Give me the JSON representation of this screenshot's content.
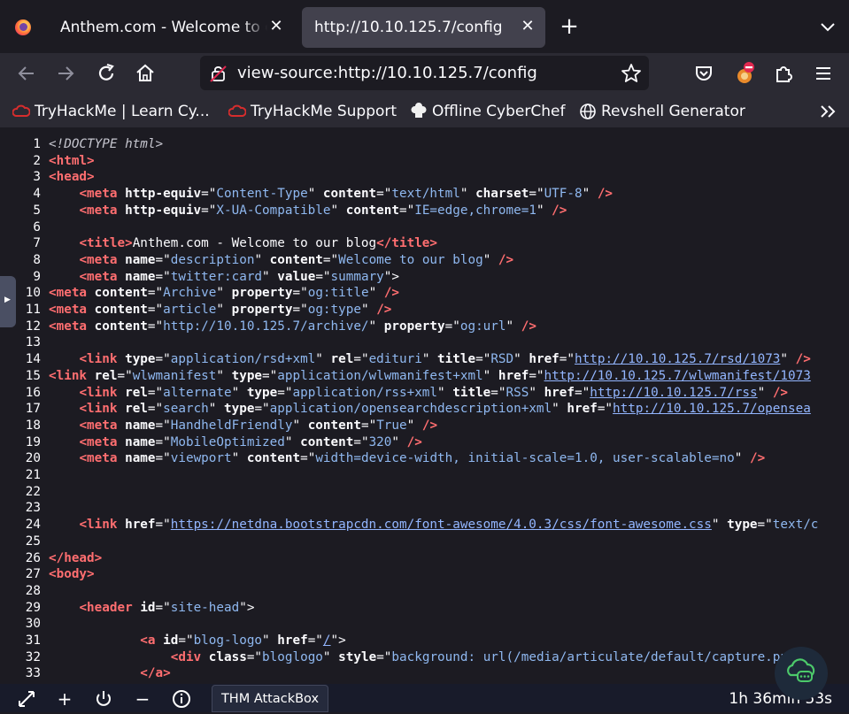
{
  "tabs": [
    {
      "title": "Anthem.com - Welcome to our blog",
      "active": false
    },
    {
      "title": "http://10.10.125.7/config",
      "active": true
    }
  ],
  "urlbar": {
    "value": "view-source:http://10.10.125.7/config"
  },
  "bookmarks": [
    {
      "label": "TryHackMe | Learn Cy...",
      "icon": "tryhackme-cloud-icon"
    },
    {
      "label": "TryHackMe Support",
      "icon": "tryhackme-cloud-icon"
    },
    {
      "label": "Offline CyberChef",
      "icon": "chef-hat-icon"
    },
    {
      "label": "Revshell Generator",
      "icon": "globe-icon"
    }
  ],
  "source_lines": [
    [
      [
        "c",
        "<!DOCTYPE html>"
      ]
    ],
    [
      [
        "t",
        "<html>"
      ]
    ],
    [
      [
        "t",
        "<head>"
      ]
    ],
    [
      [
        "p",
        "    "
      ],
      [
        "t",
        "<meta "
      ],
      [
        "a",
        "http-equiv"
      ],
      [
        "p",
        "=\""
      ],
      [
        "v",
        "Content-Type"
      ],
      [
        "p",
        "\" "
      ],
      [
        "a",
        "content"
      ],
      [
        "p",
        "=\""
      ],
      [
        "v",
        "text/html"
      ],
      [
        "p",
        "\" "
      ],
      [
        "a",
        "charset"
      ],
      [
        "p",
        "=\""
      ],
      [
        "v",
        "UTF-8"
      ],
      [
        "p",
        "\" "
      ],
      [
        "t",
        "/>"
      ]
    ],
    [
      [
        "p",
        "    "
      ],
      [
        "t",
        "<meta "
      ],
      [
        "a",
        "http-equiv"
      ],
      [
        "p",
        "=\""
      ],
      [
        "v",
        "X-UA-Compatible"
      ],
      [
        "p",
        "\" "
      ],
      [
        "a",
        "content"
      ],
      [
        "p",
        "=\""
      ],
      [
        "v",
        "IE=edge,chrome=1"
      ],
      [
        "p",
        "\" "
      ],
      [
        "t",
        "/>"
      ]
    ],
    [],
    [
      [
        "p",
        "    "
      ],
      [
        "t",
        "<title>"
      ],
      [
        "p",
        "Anthem.com - Welcome to our blog"
      ],
      [
        "t",
        "</title>"
      ]
    ],
    [
      [
        "p",
        "    "
      ],
      [
        "t",
        "<meta "
      ],
      [
        "a",
        "name"
      ],
      [
        "p",
        "=\""
      ],
      [
        "v",
        "description"
      ],
      [
        "p",
        "\" "
      ],
      [
        "a",
        "content"
      ],
      [
        "p",
        "=\""
      ],
      [
        "v",
        "Welcome to our blog"
      ],
      [
        "p",
        "\" "
      ],
      [
        "t",
        "/>"
      ]
    ],
    [
      [
        "p",
        "    "
      ],
      [
        "t",
        "<meta "
      ],
      [
        "a",
        "name"
      ],
      [
        "p",
        "=\""
      ],
      [
        "v",
        "twitter:card"
      ],
      [
        "p",
        "\" "
      ],
      [
        "a",
        "value"
      ],
      [
        "p",
        "=\""
      ],
      [
        "v",
        "summary"
      ],
      [
        "p",
        "\">"
      ]
    ],
    [
      [
        "t",
        "<meta "
      ],
      [
        "a",
        "content"
      ],
      [
        "p",
        "=\""
      ],
      [
        "v",
        "Archive"
      ],
      [
        "p",
        "\" "
      ],
      [
        "a",
        "property"
      ],
      [
        "p",
        "=\""
      ],
      [
        "v",
        "og:title"
      ],
      [
        "p",
        "\" "
      ],
      [
        "t",
        "/>"
      ]
    ],
    [
      [
        "t",
        "<meta "
      ],
      [
        "a",
        "content"
      ],
      [
        "p",
        "=\""
      ],
      [
        "v",
        "article"
      ],
      [
        "p",
        "\" "
      ],
      [
        "a",
        "property"
      ],
      [
        "p",
        "=\""
      ],
      [
        "v",
        "og:type"
      ],
      [
        "p",
        "\" "
      ],
      [
        "t",
        "/>"
      ]
    ],
    [
      [
        "t",
        "<meta "
      ],
      [
        "a",
        "content"
      ],
      [
        "p",
        "=\""
      ],
      [
        "v",
        "http://10.10.125.7/archive/"
      ],
      [
        "p",
        "\" "
      ],
      [
        "a",
        "property"
      ],
      [
        "p",
        "=\""
      ],
      [
        "v",
        "og:url"
      ],
      [
        "p",
        "\" "
      ],
      [
        "t",
        "/>"
      ]
    ],
    [],
    [
      [
        "p",
        "    "
      ],
      [
        "t",
        "<link "
      ],
      [
        "a",
        "type"
      ],
      [
        "p",
        "=\""
      ],
      [
        "v",
        "application/rsd+xml"
      ],
      [
        "p",
        "\" "
      ],
      [
        "a",
        "rel"
      ],
      [
        "p",
        "=\""
      ],
      [
        "v",
        "edituri"
      ],
      [
        "p",
        "\" "
      ],
      [
        "a",
        "title"
      ],
      [
        "p",
        "=\""
      ],
      [
        "v",
        "RSD"
      ],
      [
        "p",
        "\" "
      ],
      [
        "a",
        "href"
      ],
      [
        "p",
        "=\""
      ],
      [
        "l",
        "http://10.10.125.7/rsd/1073"
      ],
      [
        "p",
        "\" "
      ],
      [
        "t",
        "/>"
      ]
    ],
    [
      [
        "t",
        "<link "
      ],
      [
        "a",
        "rel"
      ],
      [
        "p",
        "=\""
      ],
      [
        "v",
        "wlwmanifest"
      ],
      [
        "p",
        "\" "
      ],
      [
        "a",
        "type"
      ],
      [
        "p",
        "=\""
      ],
      [
        "v",
        "application/wlwmanifest+xml"
      ],
      [
        "p",
        "\" "
      ],
      [
        "a",
        "href"
      ],
      [
        "p",
        "=\""
      ],
      [
        "l",
        "http://10.10.125.7/wlwmanifest/1073"
      ]
    ],
    [
      [
        "p",
        "    "
      ],
      [
        "t",
        "<link "
      ],
      [
        "a",
        "rel"
      ],
      [
        "p",
        "=\""
      ],
      [
        "v",
        "alternate"
      ],
      [
        "p",
        "\" "
      ],
      [
        "a",
        "type"
      ],
      [
        "p",
        "=\""
      ],
      [
        "v",
        "application/rss+xml"
      ],
      [
        "p",
        "\" "
      ],
      [
        "a",
        "title"
      ],
      [
        "p",
        "=\""
      ],
      [
        "v",
        "RSS"
      ],
      [
        "p",
        "\" "
      ],
      [
        "a",
        "href"
      ],
      [
        "p",
        "=\""
      ],
      [
        "l",
        "http://10.10.125.7/rss"
      ],
      [
        "p",
        "\" "
      ],
      [
        "t",
        "/>"
      ]
    ],
    [
      [
        "p",
        "    "
      ],
      [
        "t",
        "<link "
      ],
      [
        "a",
        "rel"
      ],
      [
        "p",
        "=\""
      ],
      [
        "v",
        "search"
      ],
      [
        "p",
        "\" "
      ],
      [
        "a",
        "type"
      ],
      [
        "p",
        "=\""
      ],
      [
        "v",
        "application/opensearchdescription+xml"
      ],
      [
        "p",
        "\" "
      ],
      [
        "a",
        "href"
      ],
      [
        "p",
        "=\""
      ],
      [
        "l",
        "http://10.10.125.7/opensea"
      ]
    ],
    [
      [
        "p",
        "    "
      ],
      [
        "t",
        "<meta "
      ],
      [
        "a",
        "name"
      ],
      [
        "p",
        "=\""
      ],
      [
        "v",
        "HandheldFriendly"
      ],
      [
        "p",
        "\" "
      ],
      [
        "a",
        "content"
      ],
      [
        "p",
        "=\""
      ],
      [
        "v",
        "True"
      ],
      [
        "p",
        "\" "
      ],
      [
        "t",
        "/>"
      ]
    ],
    [
      [
        "p",
        "    "
      ],
      [
        "t",
        "<meta "
      ],
      [
        "a",
        "name"
      ],
      [
        "p",
        "=\""
      ],
      [
        "v",
        "MobileOptimized"
      ],
      [
        "p",
        "\" "
      ],
      [
        "a",
        "content"
      ],
      [
        "p",
        "=\""
      ],
      [
        "v",
        "320"
      ],
      [
        "p",
        "\" "
      ],
      [
        "t",
        "/>"
      ]
    ],
    [
      [
        "p",
        "    "
      ],
      [
        "t",
        "<meta "
      ],
      [
        "a",
        "name"
      ],
      [
        "p",
        "=\""
      ],
      [
        "v",
        "viewport"
      ],
      [
        "p",
        "\" "
      ],
      [
        "a",
        "content"
      ],
      [
        "p",
        "=\""
      ],
      [
        "v",
        "width=device-width, initial-scale=1.0, user-scalable=no"
      ],
      [
        "p",
        "\" "
      ],
      [
        "t",
        "/>"
      ]
    ],
    [],
    [],
    [],
    [
      [
        "p",
        "    "
      ],
      [
        "t",
        "<link "
      ],
      [
        "a",
        "href"
      ],
      [
        "p",
        "=\""
      ],
      [
        "l",
        "https://netdna.bootstrapcdn.com/font-awesome/4.0.3/css/font-awesome.css"
      ],
      [
        "p",
        "\" "
      ],
      [
        "a",
        "type"
      ],
      [
        "p",
        "=\""
      ],
      [
        "v",
        "text/c"
      ]
    ],
    [],
    [
      [
        "t",
        "</head>"
      ]
    ],
    [
      [
        "t",
        "<body>"
      ]
    ],
    [],
    [
      [
        "p",
        "    "
      ],
      [
        "t",
        "<header "
      ],
      [
        "a",
        "id"
      ],
      [
        "p",
        "=\""
      ],
      [
        "v",
        "site-head"
      ],
      [
        "p",
        "\">"
      ]
    ],
    [],
    [
      [
        "p",
        "            "
      ],
      [
        "t",
        "<a "
      ],
      [
        "a",
        "id"
      ],
      [
        "p",
        "=\""
      ],
      [
        "v",
        "blog-logo"
      ],
      [
        "p",
        "\" "
      ],
      [
        "a",
        "href"
      ],
      [
        "p",
        "=\""
      ],
      [
        "l",
        "/"
      ],
      [
        "p",
        "\">"
      ]
    ],
    [
      [
        "p",
        "                "
      ],
      [
        "t",
        "<div "
      ],
      [
        "a",
        "class"
      ],
      [
        "p",
        "=\""
      ],
      [
        "v",
        "bloglogo"
      ],
      [
        "p",
        "\" "
      ],
      [
        "a",
        "style"
      ],
      [
        "p",
        "=\""
      ],
      [
        "v",
        "background: url(/media/articulate/default/capture.png?"
      ]
    ],
    [
      [
        "p",
        "            "
      ],
      [
        "t",
        "</a>"
      ]
    ]
  ],
  "taskbar": {
    "attackbox_label": "THM AttackBox",
    "timer": "1h 36min 53s"
  }
}
